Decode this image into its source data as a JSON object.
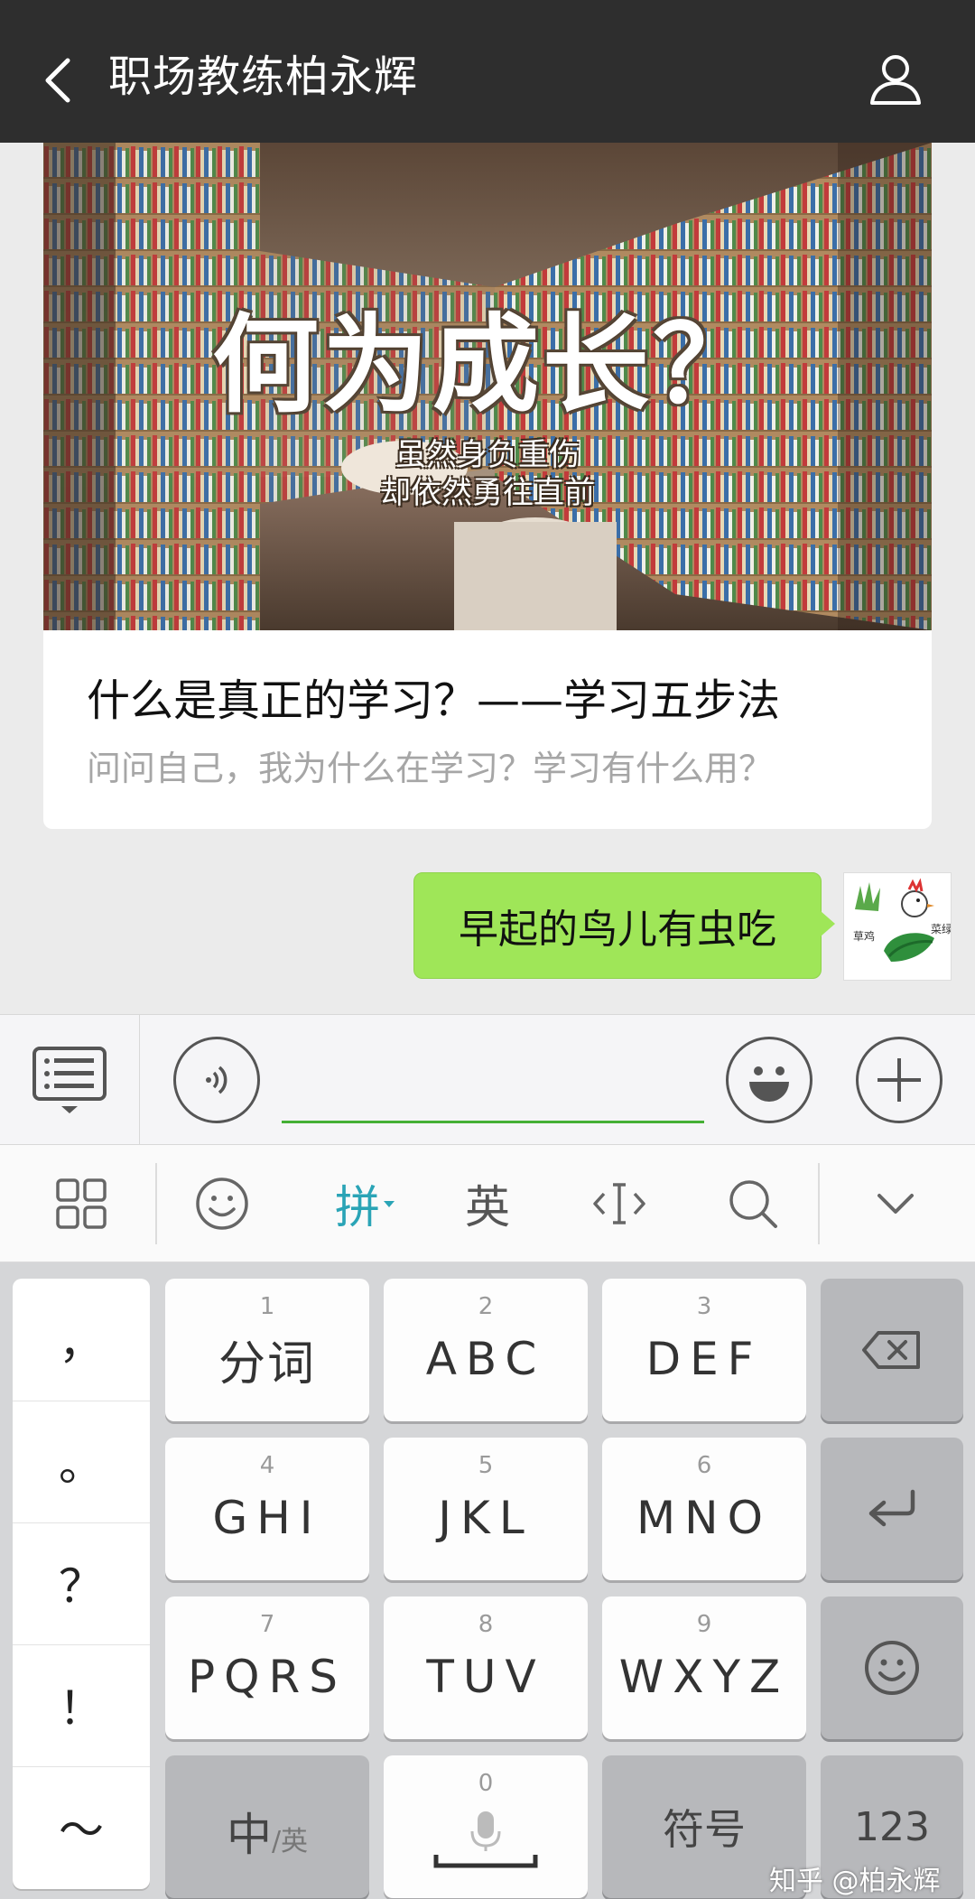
{
  "header": {
    "title": "职场教练柏永辉",
    "background": "#2e2e2e"
  },
  "chat": {
    "article": {
      "cover_title": "何为成长？",
      "cover_sub_line1": "虽然身负重伤",
      "cover_sub_line2": "却依然勇往直前",
      "title": "什么是真正的学习？——学习五步法",
      "description": "问问自己，我为什么在学习？学习有什么用？"
    },
    "my_message": {
      "text": "早起的鸟儿有虫吃",
      "bubble_color": "#9fe658"
    },
    "my_avatar": {
      "text_left": "草鸡",
      "text_right": "菜绿"
    }
  },
  "input_bar": {
    "accent_color": "#45b035",
    "icons": [
      "menu-icon",
      "voice-icon",
      "emoji-icon",
      "plus-icon"
    ]
  },
  "ime_toolbar": {
    "pinyin_label": "拼",
    "english_label": "英",
    "active_color": "#2aa4b6"
  },
  "keyboard": {
    "punctuation": [
      "，",
      "。",
      "？",
      "！",
      "～"
    ],
    "keys": [
      {
        "num": "1",
        "label": "分词"
      },
      {
        "num": "2",
        "label": "ABC"
      },
      {
        "num": "3",
        "label": "DEF"
      },
      {
        "num": "4",
        "label": "GHI"
      },
      {
        "num": "5",
        "label": "JKL"
      },
      {
        "num": "6",
        "label": "MNO"
      },
      {
        "num": "7",
        "label": "PQRS"
      },
      {
        "num": "8",
        "label": "TUV"
      },
      {
        "num": "9",
        "label": "WXYZ"
      },
      {
        "num": "0",
        "label": ""
      }
    ],
    "zh_label": "中",
    "en_small_label": "/英",
    "symbols_label": "符号",
    "numbers_label": "123"
  },
  "watermark": "知乎 @柏永辉"
}
